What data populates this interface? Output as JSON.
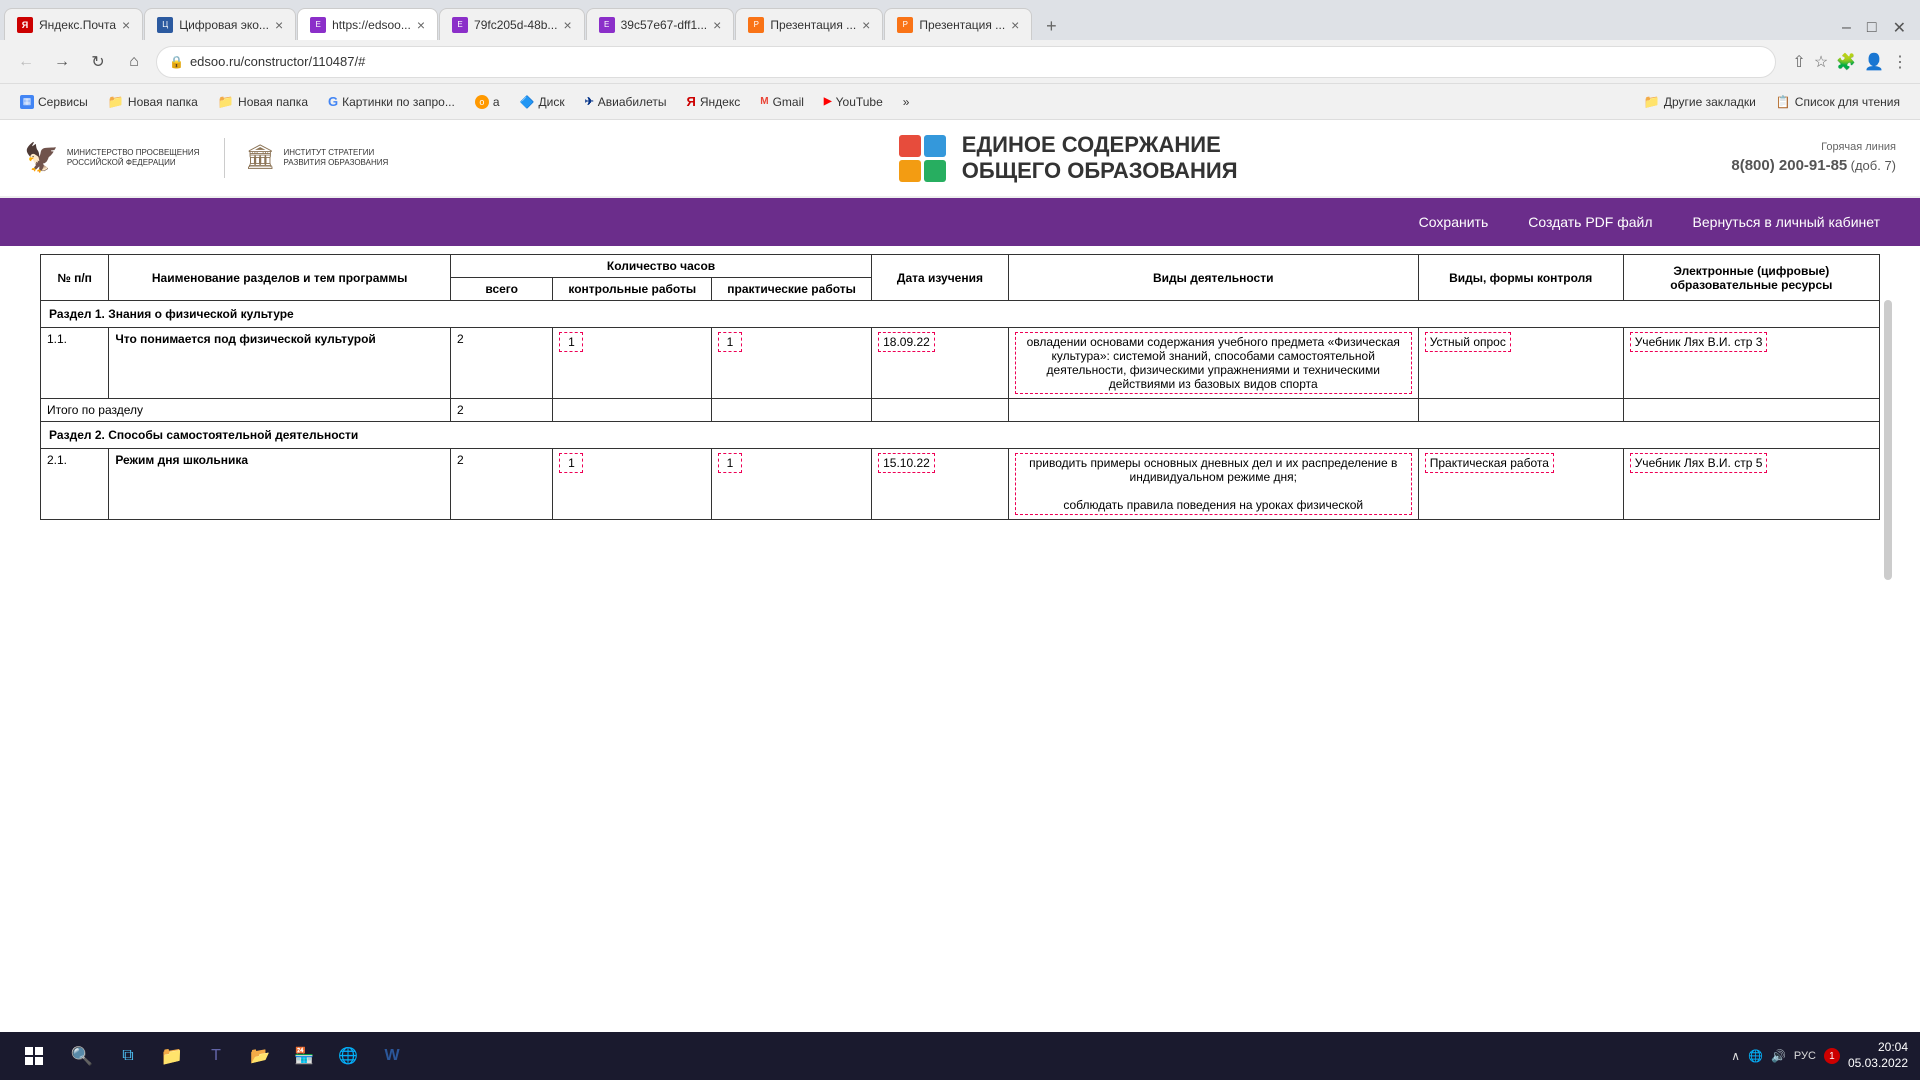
{
  "browser": {
    "tabs": [
      {
        "id": "tab-yandex-mail",
        "label": "Яндекс.Почта",
        "favicon": "ym",
        "active": false
      },
      {
        "id": "tab-cifrovaya",
        "label": "Цифровая эко...",
        "favicon": "cif",
        "active": false
      },
      {
        "id": "tab-edsoo",
        "label": "https://edsoo...",
        "favicon": "eds",
        "active": true
      },
      {
        "id": "tab-79fc",
        "label": "79fc205d-48b...",
        "favicon": "eds",
        "active": false
      },
      {
        "id": "tab-39c5",
        "label": "39c57e67-dff1...",
        "favicon": "eds",
        "active": false
      },
      {
        "id": "tab-prezent1",
        "label": "Презентация ...",
        "favicon": "pres",
        "active": false
      },
      {
        "id": "tab-prezent2",
        "label": "Презентация ...",
        "favicon": "pres",
        "active": false
      }
    ],
    "url": "edsoo.ru/constructor/110487/#",
    "bookmarks": [
      {
        "id": "bm-services",
        "label": "Сервисы",
        "type": "apps"
      },
      {
        "id": "bm-folder1",
        "label": "Новая папка",
        "type": "folder"
      },
      {
        "id": "bm-folder2",
        "label": "Новая папка",
        "type": "folder"
      },
      {
        "id": "bm-google",
        "label": "Картинки по запро...",
        "type": "google"
      },
      {
        "id": "bm-ok",
        "label": "a",
        "type": "ok"
      },
      {
        "id": "bm-drive",
        "label": "Диск",
        "type": "drive"
      },
      {
        "id": "bm-avia",
        "label": "Авиабилеты",
        "type": "avia"
      },
      {
        "id": "bm-yandex",
        "label": "Яндекс",
        "type": "yandex"
      },
      {
        "id": "bm-gmail",
        "label": "Gmail",
        "type": "gmail"
      },
      {
        "id": "bm-youtube",
        "label": "YouTube",
        "type": "youtube"
      },
      {
        "id": "bm-more",
        "label": "»",
        "type": "more"
      },
      {
        "id": "bm-other",
        "label": "Другие закладки",
        "type": "folder"
      },
      {
        "id": "bm-reading",
        "label": "Список для чтения",
        "type": "folder"
      }
    ]
  },
  "site": {
    "ministry_label": "МИНИСТЕРСТВО ПРОСВЕЩЕНИЯ РОССИЙСКОЙ ФЕДЕРАЦИИ",
    "institute_label": "ИНСТИТУТ СТРАТЕГИИ РАЗВИТИЯ ОБРАЗОВАНИЯ",
    "title_line1": "ЕДИНОЕ СОДЕРЖАНИЕ",
    "title_line2": "ОБЩЕГО ОБРАЗОВАНИЯ",
    "hotline_label": "Горячая линия",
    "hotline_number": "8(800) 200-91-85",
    "hotline_ext": "(доб. 7)"
  },
  "toolbar": {
    "save_label": "Сохранить",
    "pdf_label": "Создать PDF файл",
    "cabinet_label": "Вернуться в личный кабинет"
  },
  "table": {
    "headers": {
      "num": "№ п/п",
      "name": "Наименование разделов и тем программы",
      "hours": "Количество часов",
      "hours_total": "всего",
      "hours_control": "контрольные работы",
      "hours_practice": "практические работы",
      "date": "Дата изучения",
      "activity": "Виды деятельности",
      "control_type": "Виды, формы контроля",
      "resources": "Электронные (цифровые) образовательные ресурсы"
    },
    "sections": [
      {
        "id": "section1",
        "title_prefix": "Раздел 1.",
        "title": "Знания о физической культуре",
        "rows": [
          {
            "num": "1.1.",
            "name": "Что понимается под физической культурой",
            "total": "2",
            "control": "1",
            "practice": "1",
            "date": "18.09.22",
            "activity": "овладении основами содержания учебного предмета «Физическая культура»: системой знаний, способами самостоятельной деятельности, физическими упражнениями и техническими действиями из базовых видов спорта",
            "control_type": "Устный опрос",
            "resources": "Учебник Лях В.И. стр 3"
          }
        ],
        "total_label": "Итого по разделу",
        "total_hours": "2"
      },
      {
        "id": "section2",
        "title_prefix": "Раздел 2.",
        "title": "Способы самостоятельной деятельности",
        "rows": [
          {
            "num": "2.1.",
            "name": "Режим дня школьника",
            "total": "2",
            "control": "1",
            "practice": "1",
            "date": "15.10.22",
            "activity": "приводить примеры основных дневных дел и их распределение в индивидуальном режиме дня;\n\nсоблюдать правила поведения на уроках физической",
            "control_type": "Практическая работа",
            "resources": "Учебник Лях В.И. стр 5"
          }
        ]
      }
    ]
  },
  "taskbar": {
    "time": "20:04",
    "date": "05.03.2022",
    "lang": "РУС",
    "notification": "1"
  }
}
